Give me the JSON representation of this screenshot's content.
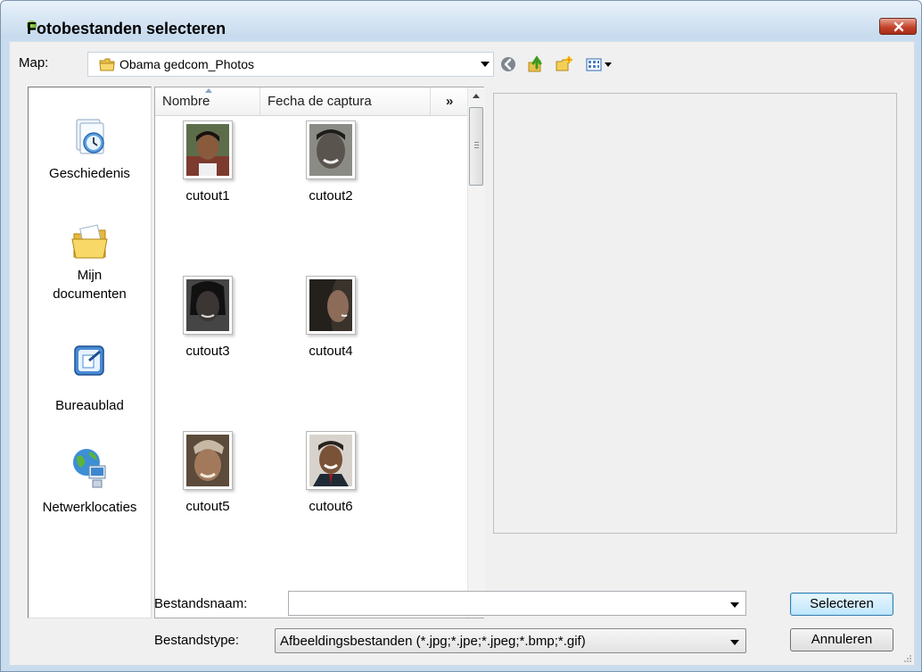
{
  "window": {
    "title": "Fotobestanden selecteren",
    "close_label": "Sluiten"
  },
  "toolbar": {
    "map_label": "Map:",
    "folder": "Obama gedcom_Photos",
    "icons": [
      "back-icon",
      "up-folder-icon",
      "new-folder-icon",
      "view-menu-icon"
    ]
  },
  "places": [
    {
      "label": "Geschiedenis",
      "icon": "history-icon"
    },
    {
      "label": "Mijn documenten",
      "icon": "my-documents-icon"
    },
    {
      "label": "Bureaublad",
      "icon": "desktop-icon"
    },
    {
      "label": "Netwerklocaties",
      "icon": "network-icon"
    }
  ],
  "columns": {
    "name": "Nombre",
    "date": "Fecha de captura",
    "more": "»"
  },
  "files": [
    {
      "name": "cutout1"
    },
    {
      "name": "cutout2"
    },
    {
      "name": "cutout3"
    },
    {
      "name": "cutout4"
    },
    {
      "name": "cutout5"
    },
    {
      "name": "cutout6"
    }
  ],
  "form": {
    "filename_label": "Bestandsnaam:",
    "filename_value": "",
    "filetype_label": "Bestandstype:",
    "filetype_value": "Afbeeldingsbestanden (*.jpg;*.jpe;*.jpeg;*.bmp;*.gif)"
  },
  "buttons": {
    "select": "Selecteren",
    "cancel": "Annuleren"
  }
}
